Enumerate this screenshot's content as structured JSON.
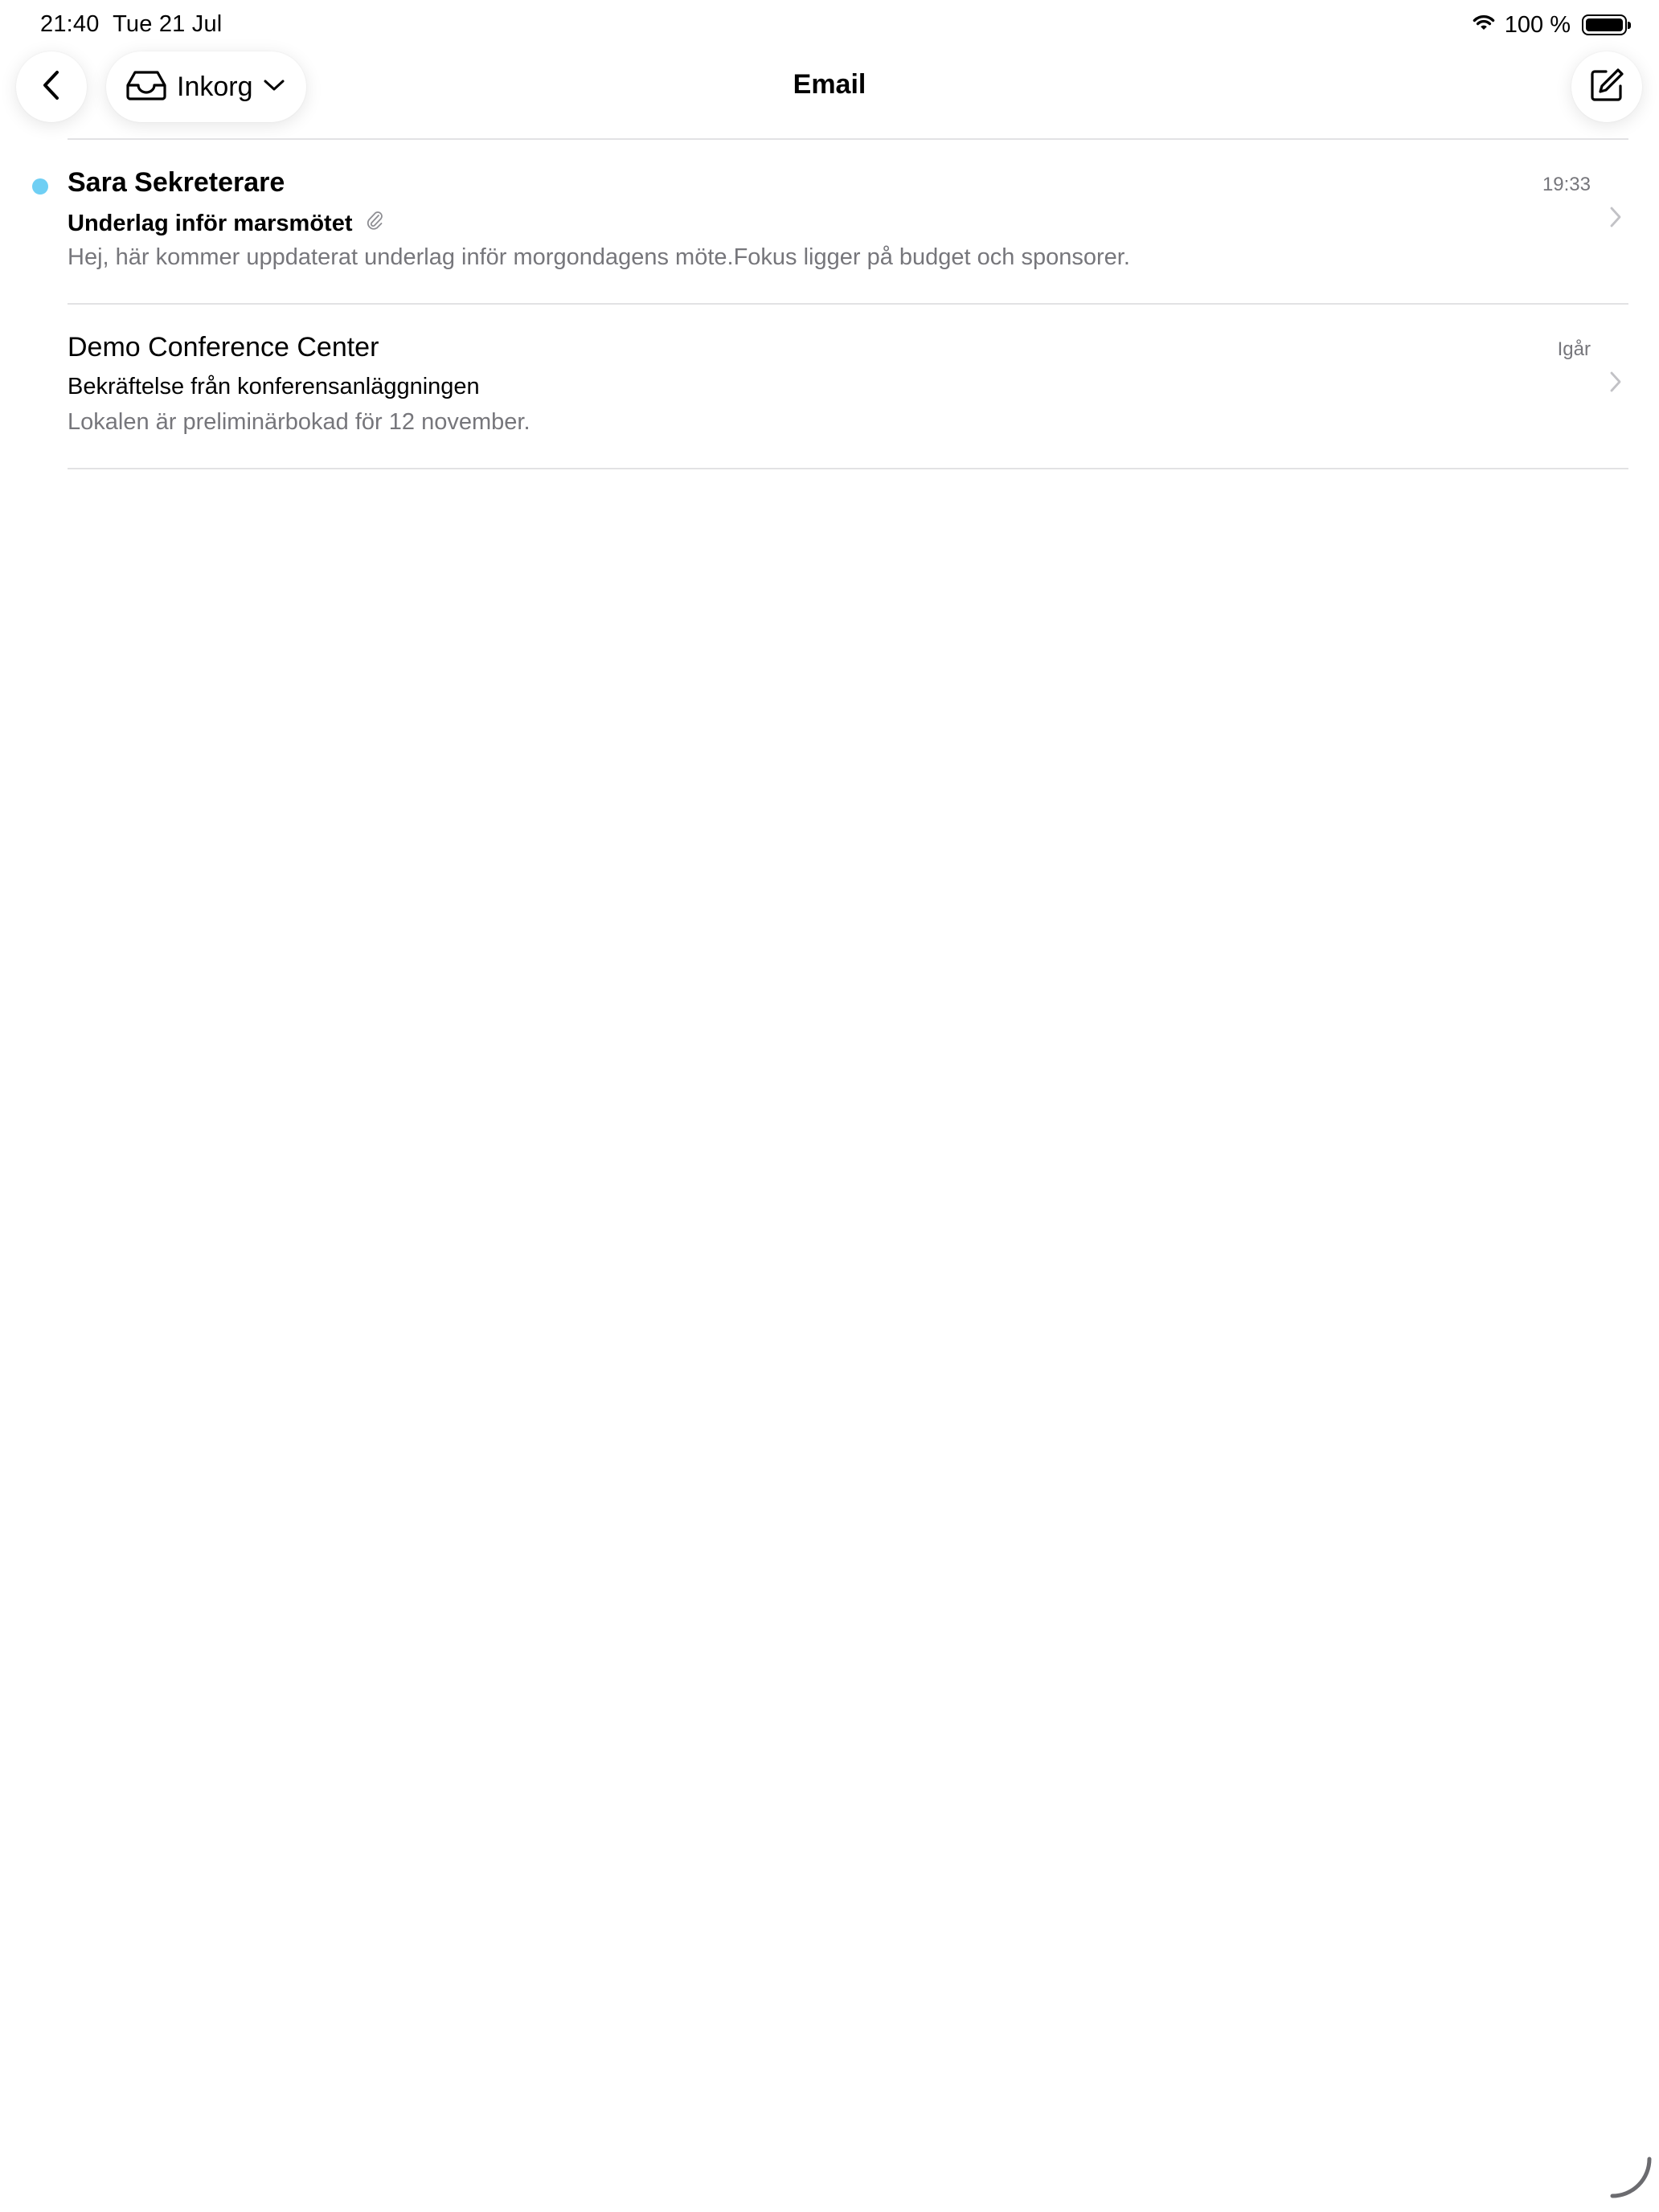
{
  "status_bar": {
    "time": "21:40",
    "date": "Tue 21 Jul",
    "battery": "100 %",
    "battery_level": 1.0
  },
  "nav": {
    "title": "Email",
    "folder_label": "Inkorg",
    "back_icon": "chevron-left-icon",
    "folder_icon": "inbox-tray-icon",
    "dropdown_icon": "chevron-down-icon",
    "compose_icon": "compose-icon"
  },
  "mails": [
    {
      "sender": "Sara Sekreterare",
      "subject": "Underlag inför marsmötet",
      "preview": "Hej, här kommer uppdaterat underlag inför morgondagens möte.Fokus ligger på budget och sponsorer.",
      "time": "19:33",
      "unread": true,
      "has_attachment": true
    },
    {
      "sender": "Demo Conference Center",
      "subject": "Bekräftelse från konferensanläggningen",
      "preview": "Lokalen är preliminärbokad för 12 november.",
      "time": "Igår",
      "unread": false,
      "has_attachment": false
    }
  ],
  "colors": {
    "unread_dot": "#6fcff4",
    "secondary_text": "#76767b",
    "divider": "#e2e2e4"
  }
}
